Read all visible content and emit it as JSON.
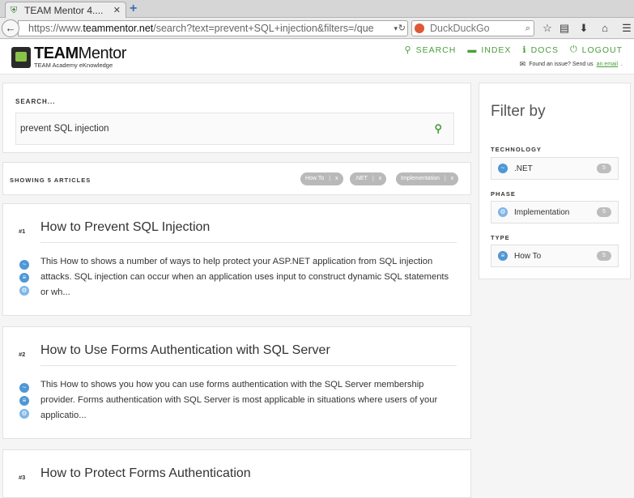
{
  "browser": {
    "tab_title": "TEAM Mentor 4....",
    "url_prefix": "https://www.",
    "url_host": "teammentor.net",
    "url_path": "/search?text=prevent+SQL+injection&filters=/que",
    "search_engine": "DuckDuckGo"
  },
  "header": {
    "brand_bold": "TEAM",
    "brand_rest": "Mentor",
    "tagline": "TEAM Academy eKnowledge",
    "nav": [
      {
        "label": "SEARCH",
        "icon": "search-icon"
      },
      {
        "label": "INDEX",
        "icon": "folder-icon"
      },
      {
        "label": "DOCS",
        "icon": "info-icon"
      },
      {
        "label": "LOGOUT",
        "icon": "power-icon"
      }
    ],
    "issue_text": "Found an issue? Send us",
    "issue_link": "an email",
    "issue_end": "."
  },
  "search": {
    "label": "SEARCH...",
    "value": "prevent SQL injection"
  },
  "results": {
    "showing": "SHOWING 5 ARTICLES",
    "chips": [
      {
        "label": "How To",
        "x": "x"
      },
      {
        "label": ".NET",
        "x": "x"
      },
      {
        "label": "Implementation",
        "x": "x"
      }
    ]
  },
  "articles": [
    {
      "num": "#1",
      "title": "How to Prevent SQL Injection",
      "body": "This How to shows a number of ways to help protect your ASP.NET application from SQL injection attacks. SQL injection can occur when an application uses input to construct dynamic SQL statements or wh..."
    },
    {
      "num": "#2",
      "title": "How to Use Forms Authentication with SQL Server",
      "body": "This How to shows you how you can use forms authentication with the SQL Server membership provider. Forms authentication with SQL Server is most applicable in situations where users of your applicatio..."
    },
    {
      "num": "#3",
      "title": "How to Protect Forms Authentication",
      "body": ""
    }
  ],
  "filter": {
    "title": "Filter by",
    "groups": [
      {
        "heading": "TECHNOLOGY",
        "item": ".NET",
        "count": "5"
      },
      {
        "heading": "PHASE",
        "item": "Implementation",
        "count": "5"
      },
      {
        "heading": "TYPE",
        "item": "How To",
        "count": "5"
      }
    ]
  },
  "colors": {
    "accent": "#4a9e3c",
    "icon_blue": "#4f97d6",
    "chip_gray": "#b9b9b9"
  }
}
